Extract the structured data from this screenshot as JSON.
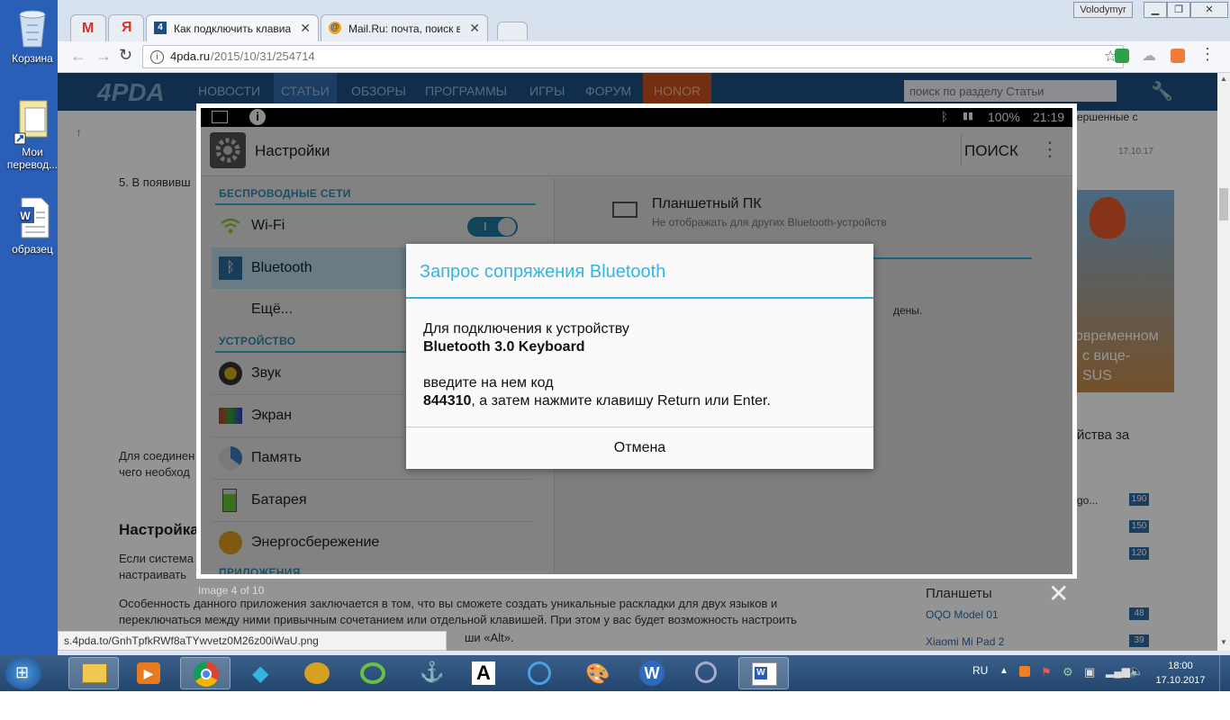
{
  "desktop": {
    "icons": [
      {
        "label": "Корзина"
      },
      {
        "label": "Мои перевод..."
      },
      {
        "label": "образец"
      }
    ]
  },
  "browser": {
    "user": "Volodymyr",
    "tabs": [
      {
        "label": "Как подключить клавиа"
      },
      {
        "label": "Mail.Ru: почта, поиск в"
      }
    ],
    "url_host": "4pda.ru",
    "url_path": "/2015/10/31/254714",
    "status_url": "s.4pda.to/GnhTpfkRWf8aTYwvetz0M26z00iWaU.png"
  },
  "site": {
    "logo": "4PDA",
    "nav": [
      "НОВОСТИ",
      "СТАТЬИ",
      "ОБЗОРЫ",
      "ПРОГРАММЫ",
      "ИГРЫ",
      "ФОРУМ",
      "HONOR"
    ],
    "search_placeholder": "поиск по разделу Статьи",
    "article_step": "5. В появивш",
    "article_para1_l1": "Для соединен",
    "article_para1_l2": "чего необход",
    "article_heading": "Настройка",
    "article_para2_l1": "Если система",
    "article_para2_l2": "настраивать",
    "article_para3_l1": "Особенность данного приложения заключается в том, что вы сможете создать уникальные раскладки для двух языков и",
    "article_para3_l2": "переключаться между ними привычным сочетанием или отдельной клавишей. При этом у вас будет возможность настроить",
    "article_para3_l3": "ши «Alt».",
    "sidebar_text1": "ершенные с",
    "sidebar_date": "17.10.17",
    "promo_l1": "овременном",
    "promo_l2": "с вице-",
    "promo_l3": "SUS",
    "poll_title": "йства за",
    "poll_item": "go...",
    "poll_counts": [
      "190",
      "150",
      "120"
    ],
    "tablets_heading": "Планшеты",
    "tablets": [
      {
        "name": "OQO Model 01",
        "count": "48"
      },
      {
        "name": "Xiaomi Mi Pad 2",
        "count": "39"
      }
    ]
  },
  "lightbox": {
    "counter": "Image 4 of 10",
    "close": "✕"
  },
  "android": {
    "status": {
      "battery": "100%",
      "time": "21:19"
    },
    "actionbar": {
      "title": "Настройки",
      "search": "ПОИСК"
    },
    "sections": {
      "wireless": "БЕСПРОВОДНЫЕ СЕТИ",
      "device": "УСТРОЙСТВО",
      "apps": "ПРИЛОЖЕНИЯ"
    },
    "items": {
      "wifi": "Wi-Fi",
      "wifi_toggle": "I",
      "bluetooth": "Bluetooth",
      "more": "Ещё...",
      "sound": "Звук",
      "screen": "Экран",
      "memory": "Память",
      "battery": "Батарея",
      "power": "Энергосбережение"
    },
    "detail": {
      "device_name": "Планшетный ПК",
      "device_sub": "Не отображать для других Bluetooth-устройств",
      "partial": "дены."
    },
    "dialog": {
      "title": "Запрос сопряжения Bluetooth",
      "line1": "Для подключения к устройству",
      "device": "Bluetooth 3.0 Keyboard",
      "line3": "введите на нем код",
      "code": "844310",
      "line4": ", а затем нажмите клавишу Return или Enter.",
      "cancel": "Отмена"
    }
  },
  "taskbar": {
    "lang": "RU",
    "time": "18:00",
    "date": "17.10.2017"
  },
  "colors": {
    "site_nav": "#1d4e82",
    "android_accent": "#33b5e5",
    "taskbar": "#2b5078"
  }
}
